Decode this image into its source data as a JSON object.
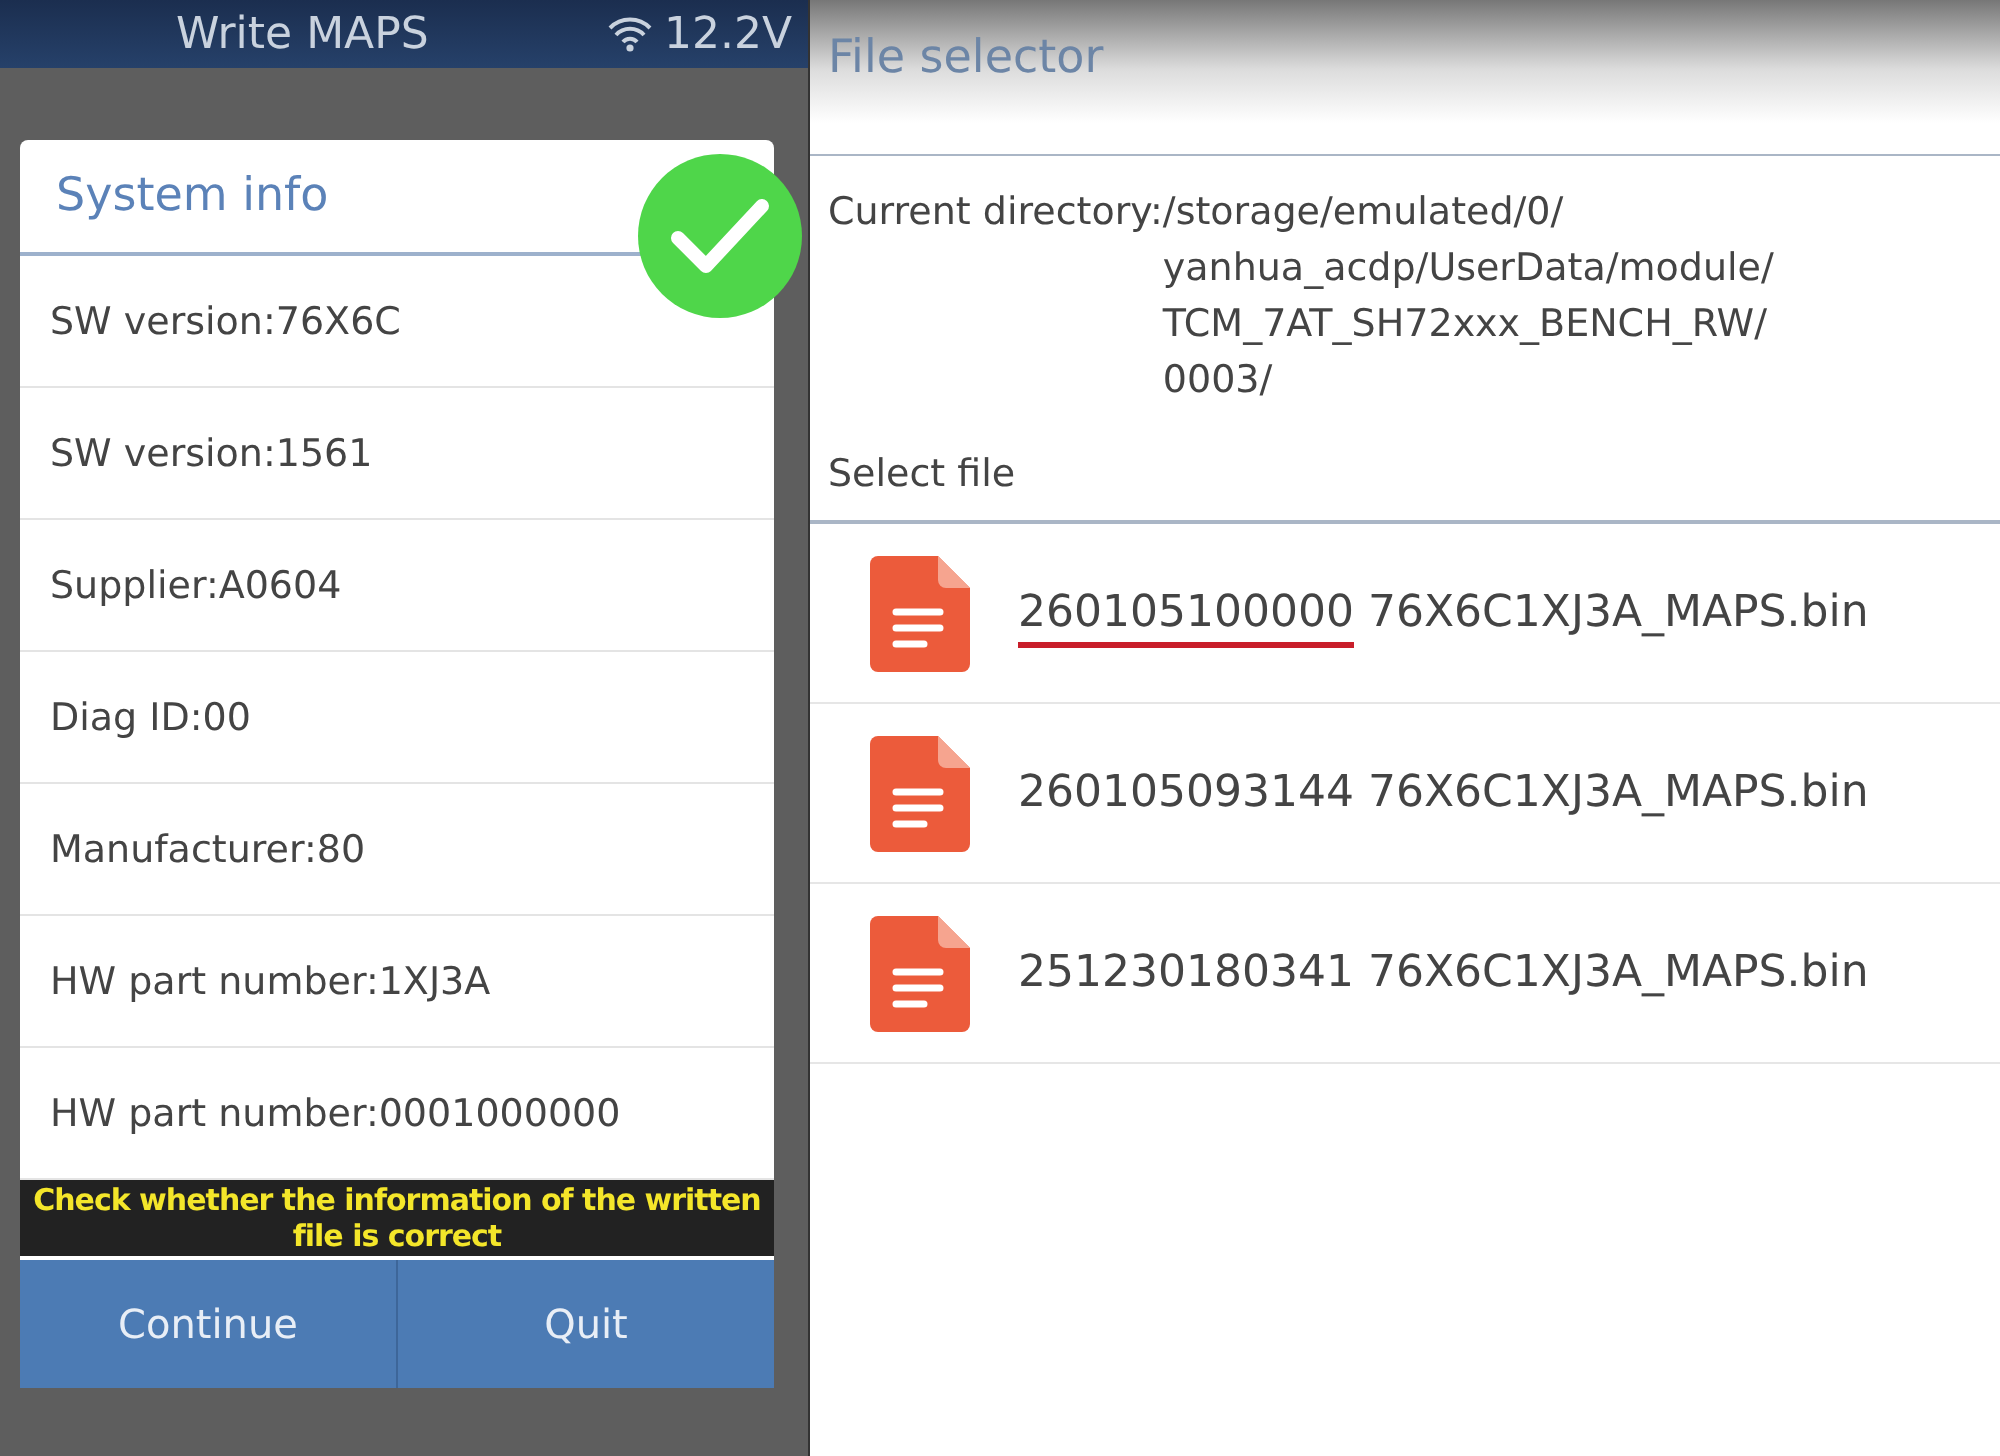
{
  "left_screen": {
    "title": "Write MAPS",
    "battery_voltage": "12.2V",
    "dialog": {
      "title": "System info",
      "success": true,
      "rows": [
        "SW version:76X6C",
        "SW version:1561",
        "Supplier:A0604",
        "Diag ID:00",
        "Manufacturer:80",
        "HW part number:1XJ3A",
        "HW part number:0001000000"
      ],
      "buttons": [
        "Continue",
        "Quit"
      ]
    },
    "caption": "Check whether the information of the written file is correct"
  },
  "right_screen": {
    "title": "File selector",
    "directory_label": "Current directory:",
    "directory_lines": [
      "/storage/emulated/0/",
      "yanhua_acdp/UserData/module/",
      "TCM_7AT_SH72xxx_BENCH_RW/",
      "0003/"
    ],
    "select_label": "Select file",
    "files": [
      {
        "id_part": "260105100000",
        "name_part": "76X6C1XJ3A_MAPS.bin",
        "underlined": true
      },
      {
        "id_part": "260105093144",
        "name_part": "76X6C1XJ3A_MAPS.bin",
        "underlined": false
      },
      {
        "id_part": "251230180341",
        "name_part": "76X6C1XJ3A_MAPS.bin",
        "underlined": false
      }
    ]
  }
}
